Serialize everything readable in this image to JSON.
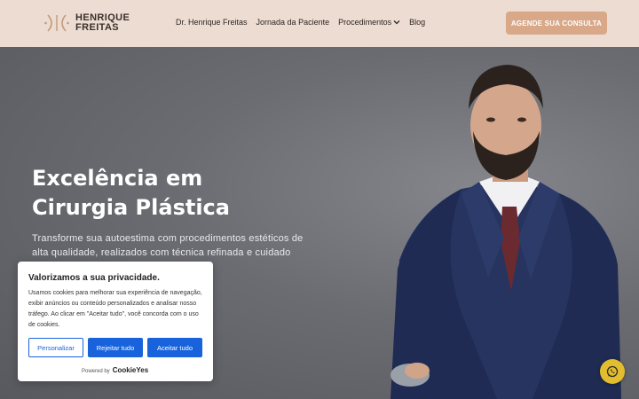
{
  "header": {
    "logo": {
      "line1": "HENRIQUE",
      "line2": "FREITAS"
    },
    "nav": [
      {
        "label": "Dr. Henrique Freitas"
      },
      {
        "label": "Jornada da Paciente"
      },
      {
        "label": "Procedimentos",
        "icon": "chevron-down-icon"
      },
      {
        "label": "Blog"
      }
    ],
    "cta_label": "AGENDE SUA CONSULTA"
  },
  "hero": {
    "title_line1": "Excelência em",
    "title_line2": "Cirurgia Plástica",
    "text": "Transforme sua autoestima com procedimentos estéticos de alta qualidade, realizados com técnica refinada e cuidado"
  },
  "cookie": {
    "title": "Valorizamos a sua privacidade.",
    "text": "Usamos cookies para melhorar sua experiência de navegação, exibir anúncios ou conteúdo personalizados e analisar nosso tráfego. Ao clicar em \"Aceitar tudo\", você concorda com o uso de cookies.",
    "customize_label": "Personalizar",
    "reject_label": "Rejeitar tudo",
    "accept_label": "Aceitar tudo",
    "powered_label": "Powered by",
    "brand": "CookieYes"
  },
  "colors": {
    "header_bg": "#ecdcd2",
    "cta_bg": "#d8a889",
    "cookie_primary": "#1863dc",
    "whatsapp_bg": "#e2bd2d"
  },
  "floating": {
    "icon": "whatsapp-icon"
  }
}
